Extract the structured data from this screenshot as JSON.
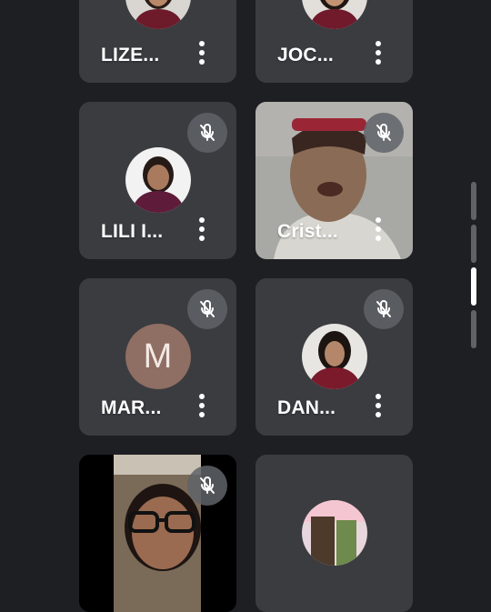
{
  "participants": [
    {
      "name": "LIZE...",
      "type": "photo",
      "muted": false
    },
    {
      "name": "JOC...",
      "type": "photo",
      "muted": false
    },
    {
      "name": "LILI I...",
      "type": "photo",
      "muted": true
    },
    {
      "name": "Crist...",
      "type": "video",
      "muted": true
    },
    {
      "name": "MAR...",
      "type": "letter",
      "initial": "M",
      "avatar_color": "#8f6e63",
      "muted": true
    },
    {
      "name": "DAN...",
      "type": "photo",
      "muted": true
    },
    {
      "name": "",
      "type": "video",
      "muted": true
    },
    {
      "name": "",
      "type": "photo",
      "muted": false
    }
  ],
  "icons": {
    "mic_off": "mic-off-icon",
    "more": "more-vert-icon"
  },
  "colors": {
    "background": "#1e1f23",
    "tile": "#3b3c40",
    "mic_badge": "#5f6368"
  }
}
